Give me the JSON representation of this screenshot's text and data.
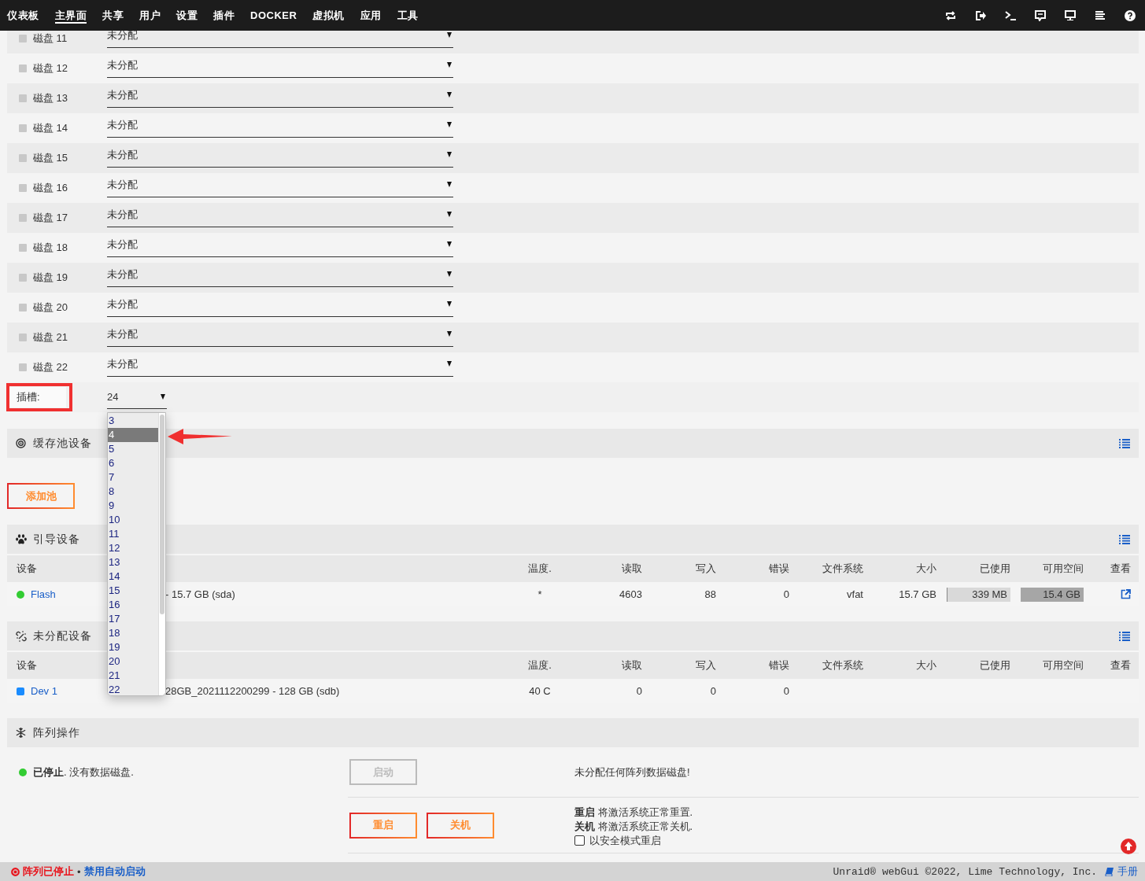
{
  "nav": {
    "tabs": [
      {
        "label": "仪表板",
        "selected": false
      },
      {
        "label": "主界面",
        "selected": true
      },
      {
        "label": "共享",
        "selected": false
      },
      {
        "label": "用户",
        "selected": false
      },
      {
        "label": "设置",
        "selected": false
      },
      {
        "label": "插件",
        "selected": false
      },
      {
        "label": "DOCKER",
        "selected": false
      },
      {
        "label": "虚拟机",
        "selected": false
      },
      {
        "label": "应用",
        "selected": false
      },
      {
        "label": "工具",
        "selected": false
      }
    ]
  },
  "disk_rows": [
    {
      "label": "磁盘 11",
      "value": "未分配"
    },
    {
      "label": "磁盘 12",
      "value": "未分配"
    },
    {
      "label": "磁盘 13",
      "value": "未分配"
    },
    {
      "label": "磁盘 14",
      "value": "未分配"
    },
    {
      "label": "磁盘 15",
      "value": "未分配"
    },
    {
      "label": "磁盘 16",
      "value": "未分配"
    },
    {
      "label": "磁盘 17",
      "value": "未分配"
    },
    {
      "label": "磁盘 18",
      "value": "未分配"
    },
    {
      "label": "磁盘 19",
      "value": "未分配"
    },
    {
      "label": "磁盘 20",
      "value": "未分配"
    },
    {
      "label": "磁盘 21",
      "value": "未分配"
    },
    {
      "label": "磁盘 22",
      "value": "未分配"
    }
  ],
  "slots": {
    "label": "插槽:",
    "value": "24",
    "options": [
      {
        "label": "3",
        "selected": false
      },
      {
        "label": "4",
        "selected": true
      },
      {
        "label": "5",
        "selected": false
      },
      {
        "label": "6",
        "selected": false
      },
      {
        "label": "7",
        "selected": false
      },
      {
        "label": "8",
        "selected": false
      },
      {
        "label": "9",
        "selected": false
      },
      {
        "label": "10",
        "selected": false
      },
      {
        "label": "11",
        "selected": false
      },
      {
        "label": "12",
        "selected": false
      },
      {
        "label": "13",
        "selected": false
      },
      {
        "label": "14",
        "selected": false
      },
      {
        "label": "15",
        "selected": false
      },
      {
        "label": "16",
        "selected": false
      },
      {
        "label": "17",
        "selected": false
      },
      {
        "label": "18",
        "selected": false
      },
      {
        "label": "19",
        "selected": false
      },
      {
        "label": "20",
        "selected": false
      },
      {
        "label": "21",
        "selected": false
      },
      {
        "label": "22",
        "selected": false
      }
    ]
  },
  "cache_pool": {
    "title": "缓存池设备",
    "button": "添加池"
  },
  "boot_device": {
    "title": "引导设备",
    "columns": [
      "设备",
      "温度.",
      "读取",
      "写入",
      "错误",
      "文件系统",
      "大小",
      "已使用",
      "可用空间",
      "查看"
    ],
    "rows": [
      {
        "device": "Flash",
        "kind": "circle",
        "color": "#33cc33",
        "identification": "- 15.7 GB (sda)",
        "temp": "*",
        "reads": "4603",
        "writes": "88",
        "errors": "0",
        "fs": "vfat",
        "size": "15.7 GB",
        "used": "339 MB",
        "free": "15.4 GB"
      }
    ]
  },
  "unassigned_devices": {
    "title": "未分配设备",
    "columns": [
      "设备",
      "温度.",
      "读取",
      "写入",
      "错误",
      "文件系统",
      "大小",
      "已使用",
      "可用空间",
      "查看"
    ],
    "rows": [
      {
        "device": "Dev 1",
        "kind": "square",
        "color": "#1a8cff",
        "identification": "28GB_2021112200299 - 128 GB (sdb)",
        "temp": "40 C",
        "reads": "0",
        "writes": "0",
        "errors": "0"
      }
    ]
  },
  "array_operations": {
    "title": "阵列操作",
    "status": {
      "text": "**已停止**. 没有数据磁盘.",
      "color": "#33cc33"
    },
    "start_button": {
      "label": "启动",
      "disabled": true
    },
    "start_note": "未分配任何阵列数据磁盘!",
    "reboot_button": "重启",
    "shutdown_button": "关机",
    "notes": [
      "**重启** 将激活系统正常重置.",
      "**关机** 将激活系统正常关机."
    ],
    "safe_mode": {
      "label": "以安全模式重启",
      "checked": false
    }
  },
  "footer": {
    "status": "阵列已停止",
    "separator": "•",
    "autostart_link": "禁用自动启动",
    "copyright": "Unraid® webGui ©2022, Lime Technology, Inc.",
    "manual": "手册"
  }
}
